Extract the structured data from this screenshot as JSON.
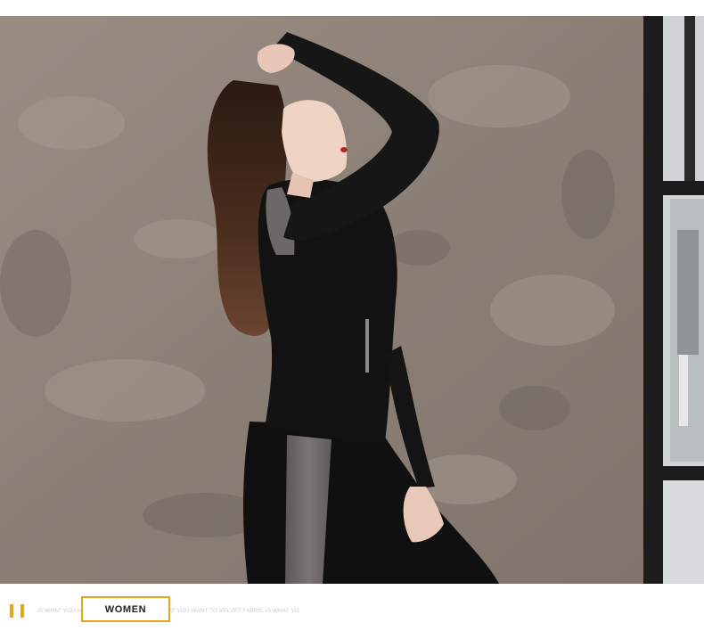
{
  "banner": {
    "label": "WOMEN",
    "tagline": "IS WHAT YOU WANT TO VELVET FABRIC IS WHAT YOU WANT TO VELVET FABRIC IS WHAT YO"
  },
  "colors": {
    "accent": "#e6a619",
    "wall": "#8e8178",
    "outfit": "#121212",
    "panel": "#6b6866"
  }
}
